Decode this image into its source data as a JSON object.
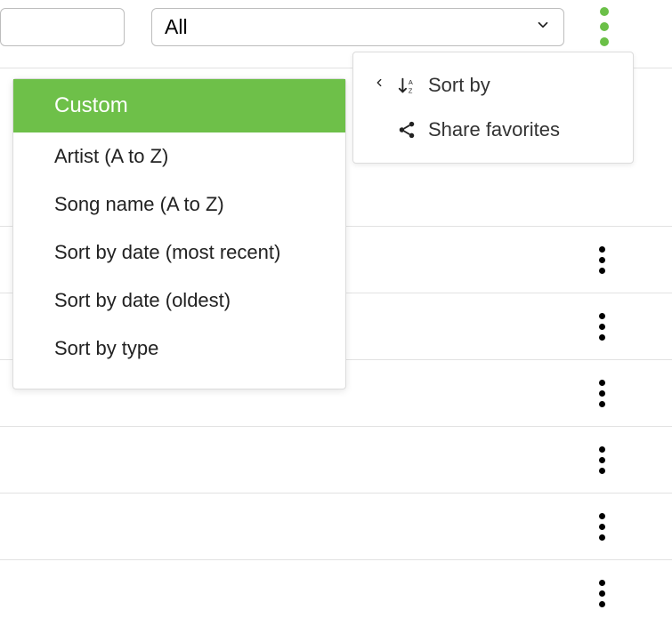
{
  "header": {
    "dropdown_value": "All"
  },
  "context_menu": {
    "sort_by_label": "Sort by",
    "share_label": "Share favorites"
  },
  "sort_options": [
    {
      "key": "custom",
      "label": "Custom",
      "selected": true
    },
    {
      "key": "artist",
      "label": "Artist (A to Z)",
      "selected": false
    },
    {
      "key": "song",
      "label": "Song name (A to Z)",
      "selected": false
    },
    {
      "key": "date_recent",
      "label": "Sort by date (most recent)",
      "selected": false
    },
    {
      "key": "date_oldest",
      "label": "Sort by date (oldest)",
      "selected": false
    },
    {
      "key": "type",
      "label": "Sort by type",
      "selected": false
    }
  ],
  "list_rows_count": 7
}
